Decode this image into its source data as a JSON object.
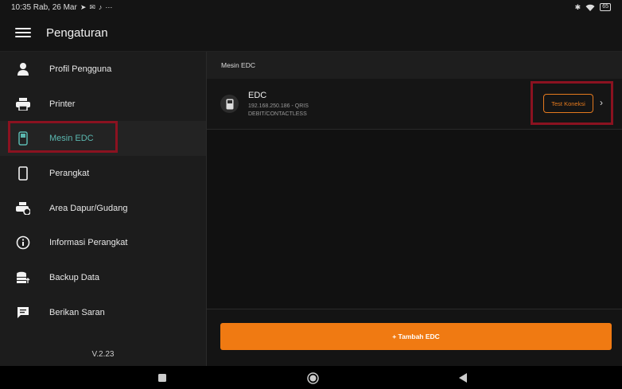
{
  "status_bar": {
    "time": "10:35 Rab, 26 Mar",
    "battery": "65"
  },
  "app_bar": {
    "title": "Pengaturan"
  },
  "sidebar": {
    "items": [
      {
        "label": "Profil Pengguna",
        "icon": "person-icon"
      },
      {
        "label": "Printer",
        "icon": "printer-icon"
      },
      {
        "label": "Mesin EDC",
        "icon": "edc-machine-icon",
        "active": true
      },
      {
        "label": "Perangkat",
        "icon": "phone-icon"
      },
      {
        "label": "Area Dapur/Gudang",
        "icon": "kitchen-printer-icon"
      },
      {
        "label": "Informasi Perangkat",
        "icon": "info-icon"
      },
      {
        "label": "Backup Data",
        "icon": "database-backup-icon"
      },
      {
        "label": "Berikan Saran",
        "icon": "feedback-icon"
      }
    ],
    "version": "V.2.23"
  },
  "content": {
    "section_title": "Mesin EDC",
    "edc_item": {
      "name": "EDC",
      "detail_line1": "192.168.250.186 - QRIS",
      "detail_line2": "DEBIT/CONTACTLESS",
      "test_button": "Test Koneksi"
    },
    "add_button": "+ Tambah EDC"
  },
  "colors": {
    "accent": "#f07a12",
    "active_teal": "#5bb8b0",
    "highlight": "#8b1220"
  }
}
